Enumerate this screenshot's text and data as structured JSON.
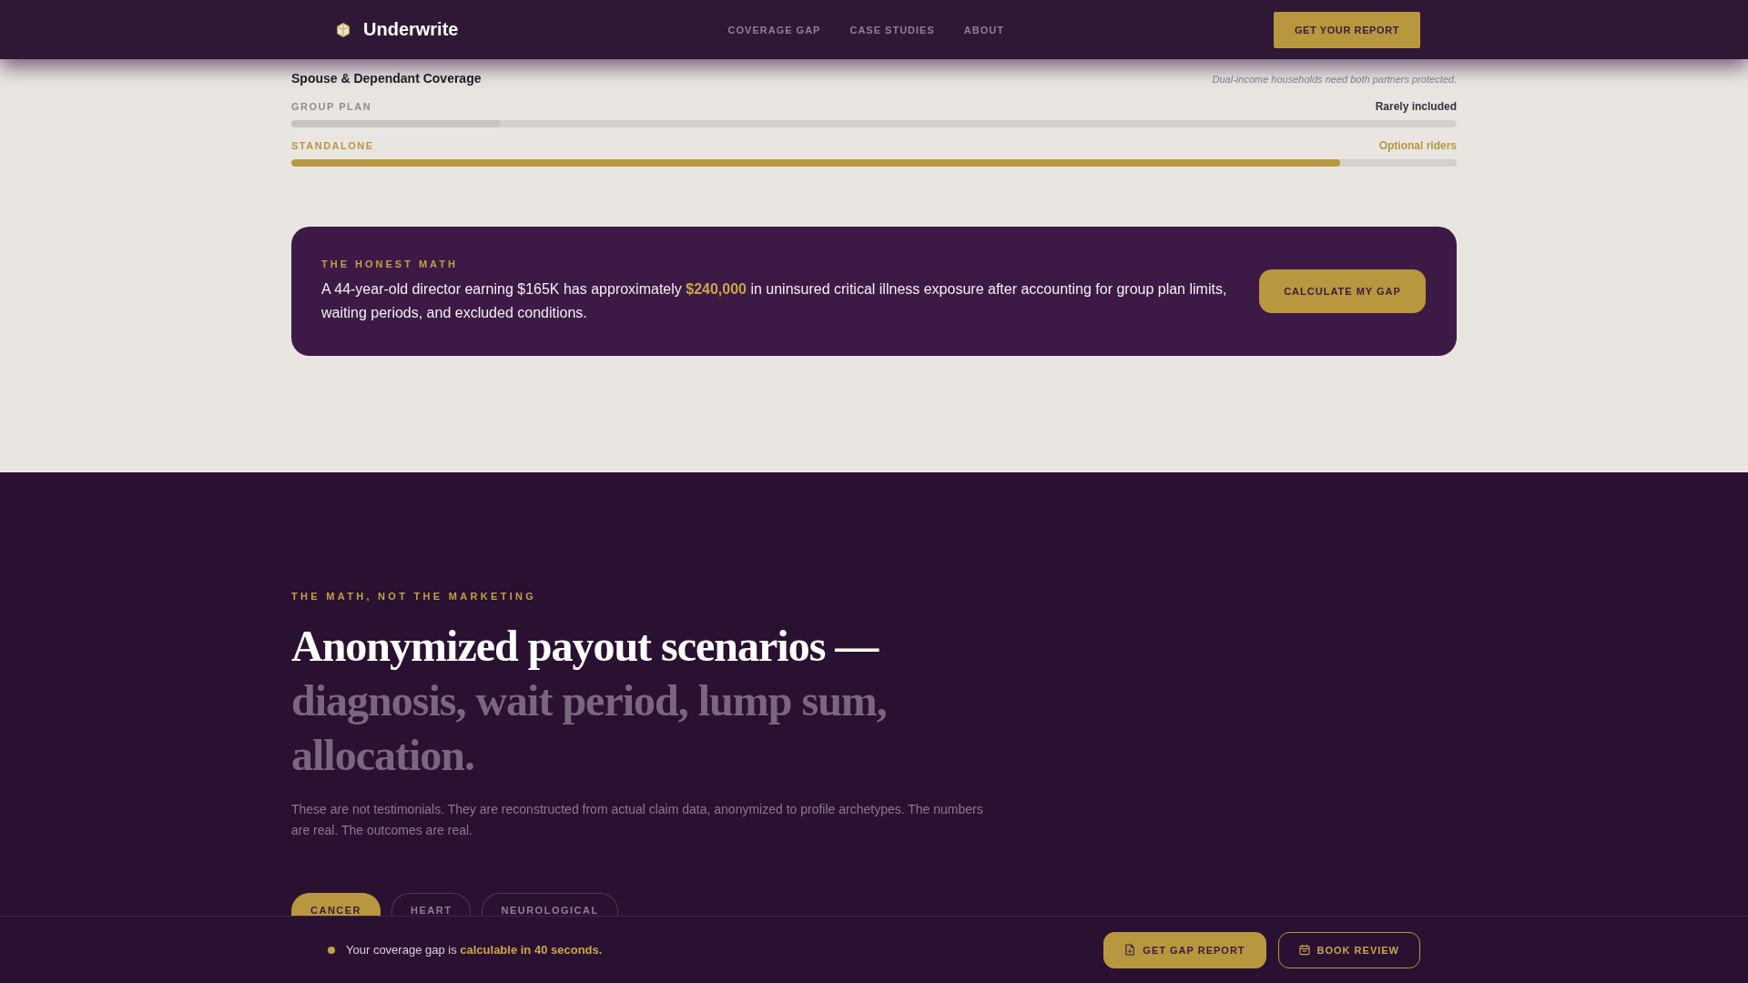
{
  "header": {
    "logo": "Underwrite",
    "nav": [
      {
        "label": "COVERAGE GAP"
      },
      {
        "label": "CASE STUDIES"
      },
      {
        "label": "ABOUT"
      }
    ],
    "cta": "GET YOUR REPORT"
  },
  "coverage": {
    "title": "Spouse & Dependant Coverage",
    "note": "Dual-income households need both partners protected.",
    "rows": [
      {
        "label": "GROUP PLAN",
        "value": "Rarely included",
        "highlighted": false,
        "level": 0.18
      },
      {
        "label": "STANDALONE",
        "value": "Optional riders",
        "highlighted": true,
        "level": 0.9
      }
    ]
  },
  "honest_math": {
    "eyebrow": "THE HONEST MATH",
    "text": "A 44-year-old director earning $165K has approximately **$240,000** in uninsured critical illness exposure after accounting for group plan limits, waiting periods, and excluded conditions.",
    "button": "CALCULATE MY GAP"
  },
  "scenarios": {
    "eyebrow": "THE MATH, NOT THE MARKETING",
    "heading": "Anonymized payout scenarios —",
    "heading_muted": "diagnosis, wait period, lump sum, allocation.",
    "description": "These are not testimonials. They are reconstructed from actual claim data, anonymized to profile archetypes. The numbers are real. The outcomes are real.",
    "tabs": [
      {
        "label": "CANCER",
        "selected": true
      },
      {
        "label": "HEART",
        "selected": false
      },
      {
        "label": "NEUROLOGICAL",
        "selected": false
      }
    ]
  },
  "cta_bar": {
    "text": "Your coverage gap is **calculable in 40 seconds.**",
    "buttons": [
      {
        "label": "GET GAP REPORT",
        "kind": "primary"
      },
      {
        "label": "BOOK REVIEW",
        "kind": "outline"
      }
    ]
  }
}
